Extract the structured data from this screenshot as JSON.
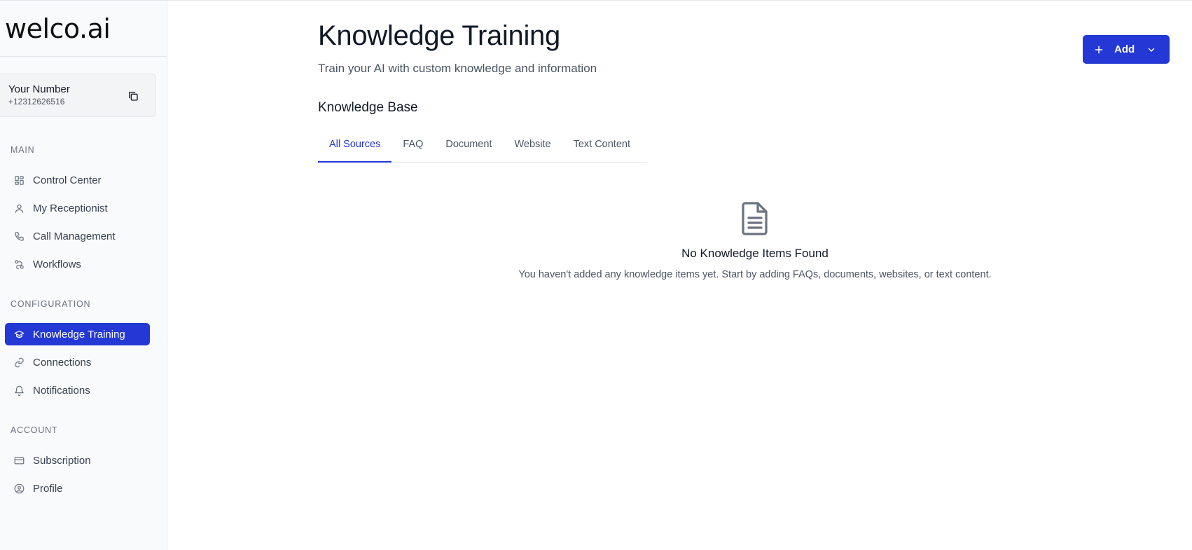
{
  "brand": {
    "logo_text": "welco.ai"
  },
  "number_card": {
    "label": "Your Number",
    "value": "+12312626516"
  },
  "sidebar": {
    "main_label": "MAIN",
    "main_items": [
      {
        "label": "Control Center",
        "icon": "grid-icon"
      },
      {
        "label": "My Receptionist",
        "icon": "user-icon"
      },
      {
        "label": "Call Management",
        "icon": "phone-icon"
      },
      {
        "label": "Workflows",
        "icon": "workflow-icon"
      }
    ],
    "config_label": "CONFIGURATION",
    "config_items": [
      {
        "label": "Knowledge Training",
        "icon": "graduation-cap-icon",
        "active": true
      },
      {
        "label": "Connections",
        "icon": "link-icon"
      },
      {
        "label": "Notifications",
        "icon": "bell-icon"
      }
    ],
    "account_label": "ACCOUNT",
    "account_items": [
      {
        "label": "Subscription",
        "icon": "credit-card-icon"
      },
      {
        "label": "Profile",
        "icon": "user-circle-icon"
      }
    ]
  },
  "header": {
    "title": "Knowledge Training",
    "subtitle": "Train your AI with custom knowledge and information",
    "add_label": "Add"
  },
  "knowledge_base": {
    "title": "Knowledge Base",
    "tabs": [
      "All Sources",
      "FAQ",
      "Document",
      "Website",
      "Text Content"
    ],
    "active_tab": "All Sources",
    "empty_title": "No Knowledge Items Found",
    "empty_desc": "You haven't added any knowledge items yet. Start by adding FAQs, documents, websites, or text content."
  },
  "colors": {
    "accent": "#2338d4",
    "sidebar_bg": "#f9fafb"
  }
}
